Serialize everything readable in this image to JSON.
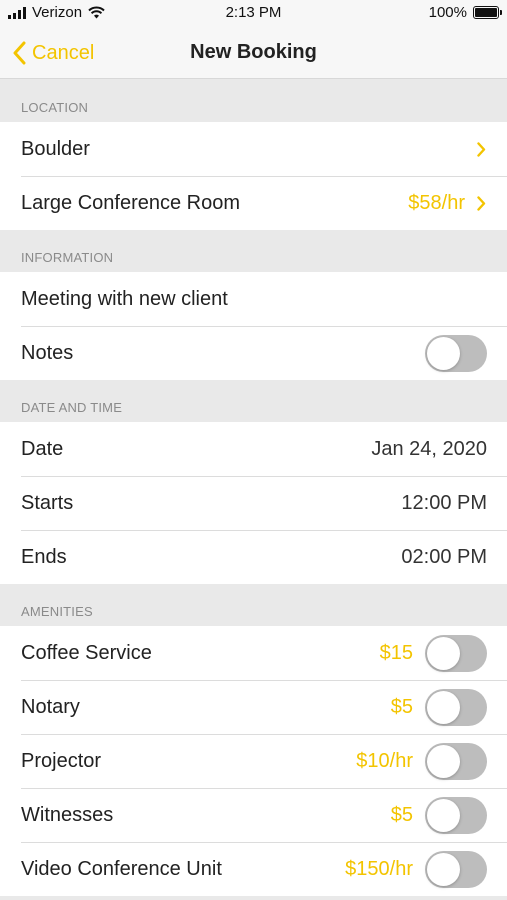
{
  "status_bar": {
    "carrier": "Verizon",
    "time": "2:13 PM",
    "battery": "100%"
  },
  "nav": {
    "cancel_label": "Cancel",
    "title": "New Booking"
  },
  "accent_color": "#f3c400",
  "sections": {
    "location": {
      "header": "LOCATION",
      "city": "Boulder",
      "room": "Large Conference Room",
      "room_price": "$58/hr"
    },
    "information": {
      "header": "INFORMATION",
      "title": "Meeting with new client",
      "notes_label": "Notes",
      "notes_enabled": false
    },
    "datetime": {
      "header": "DATE AND TIME",
      "date_label": "Date",
      "date_value": "Jan 24, 2020",
      "starts_label": "Starts",
      "starts_value": "12:00 PM",
      "ends_label": "Ends",
      "ends_value": "02:00 PM"
    },
    "amenities": {
      "header": "AMENITIES",
      "items": [
        {
          "label": "Coffee Service",
          "price": "$15",
          "enabled": false
        },
        {
          "label": "Notary",
          "price": "$5",
          "enabled": false
        },
        {
          "label": "Projector",
          "price": "$10/hr",
          "enabled": false
        },
        {
          "label": "Witnesses",
          "price": "$5",
          "enabled": false
        },
        {
          "label": "Video Conference Unit",
          "price": "$150/hr",
          "enabled": false
        }
      ]
    }
  }
}
